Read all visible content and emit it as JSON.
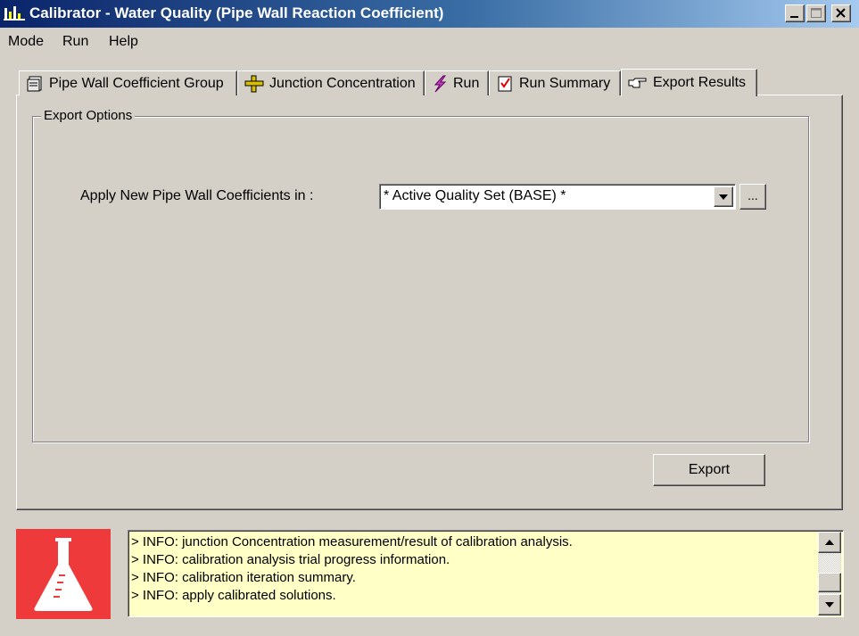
{
  "window": {
    "title": "Calibrator - Water Quality (Pipe Wall Reaction Coefficient)"
  },
  "menu": {
    "items": [
      "Mode",
      "Run",
      "Help"
    ]
  },
  "tabs": [
    {
      "label": "Pipe Wall Coefficient Group",
      "icon": "database-icon"
    },
    {
      "label": "Junction Concentration",
      "icon": "junction-icon"
    },
    {
      "label": "Run",
      "icon": "lightning-icon"
    },
    {
      "label": "Run Summary",
      "icon": "checklist-icon"
    },
    {
      "label": "Export Results",
      "icon": "pointing-hand-icon",
      "active": true
    }
  ],
  "export_options": {
    "group_title": "Export Options",
    "apply_label": "Apply New Pipe Wall Coefficients in :",
    "selected_value": "* Active Quality Set (BASE) *",
    "browse_label": "...",
    "export_button": "Export"
  },
  "log": {
    "lines": [
      "> INFO: junction Concentration measurement/result of calibration analysis.",
      "> INFO: calibration analysis trial progress information.",
      "> INFO: calibration iteration summary.",
      "> INFO: apply calibrated solutions."
    ]
  },
  "colors": {
    "titlebar_start": "#0a246a",
    "titlebar_end": "#a6caf0",
    "log_background": "#ffffc6",
    "flask_panel": "#ee3a3a"
  }
}
